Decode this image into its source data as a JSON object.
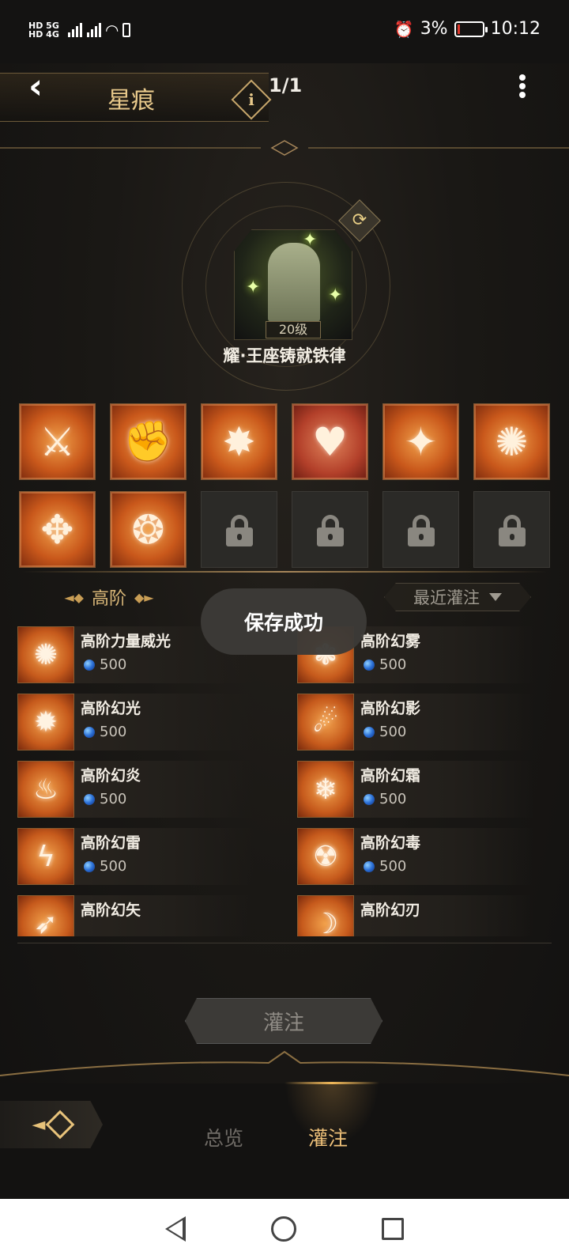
{
  "status_bar": {
    "network_left": "HD 5G HD 4G",
    "battery_pct": "3%",
    "time": "10:12"
  },
  "header": {
    "title": "星痕",
    "info_label": "i",
    "page_indicator": "1/1"
  },
  "emblem": {
    "level": "20级",
    "name": "耀·王座铸就铁律"
  },
  "skills": {
    "row1": [
      {
        "glyph": "⚔",
        "state": "active"
      },
      {
        "glyph": "✊",
        "state": "active"
      },
      {
        "glyph": "✸",
        "state": "active"
      },
      {
        "glyph": "♥",
        "state": "active-heart"
      },
      {
        "glyph": "✦",
        "state": "active"
      },
      {
        "glyph": "✺",
        "state": "active"
      }
    ],
    "row2": [
      {
        "glyph": "✥",
        "state": "active"
      },
      {
        "glyph": "❂",
        "state": "active"
      },
      {
        "glyph": "lock",
        "state": "locked"
      },
      {
        "glyph": "lock",
        "state": "locked"
      },
      {
        "glyph": "lock",
        "state": "locked"
      },
      {
        "glyph": "lock",
        "state": "locked"
      }
    ]
  },
  "list": {
    "tier_label": "高阶",
    "sort_label": "最近灌注",
    "items": [
      {
        "name": "高阶力量威光",
        "cost": "500",
        "glyph": "✺"
      },
      {
        "name": "高阶幻雾",
        "cost": "500",
        "glyph": "❃"
      },
      {
        "name": "高阶幻光",
        "cost": "500",
        "glyph": "✹"
      },
      {
        "name": "高阶幻影",
        "cost": "500",
        "glyph": "☄"
      },
      {
        "name": "高阶幻炎",
        "cost": "500",
        "glyph": "♨"
      },
      {
        "name": "高阶幻霜",
        "cost": "500",
        "glyph": "❄"
      },
      {
        "name": "高阶幻雷",
        "cost": "500",
        "glyph": "ϟ"
      },
      {
        "name": "高阶幻毒",
        "cost": "500",
        "glyph": "☢"
      },
      {
        "name": "高阶幻矢",
        "cost": "",
        "glyph": "➶"
      },
      {
        "name": "高阶幻刃",
        "cost": "",
        "glyph": "☽"
      }
    ]
  },
  "toast": {
    "text": "保存成功"
  },
  "inject_button": {
    "label": "灌注"
  },
  "tabs": {
    "overview": "总览",
    "inject": "灌注"
  },
  "colors": {
    "accent_gold": "#e8c98b",
    "orange_icon": "#c9581b",
    "battery_low": "#e23a2e"
  }
}
